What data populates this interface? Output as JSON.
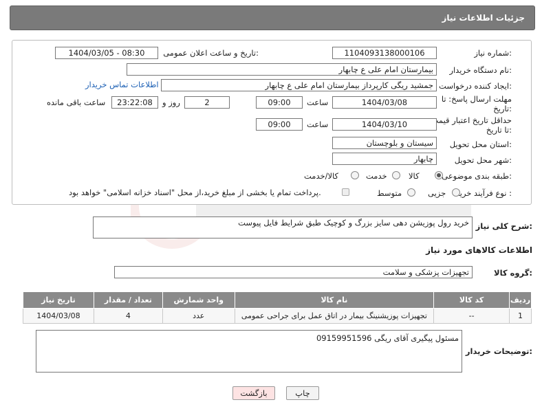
{
  "header": {
    "title": "جزئیات اطلاعات نیاز"
  },
  "form": {
    "need_number": {
      "label": "شماره نیاز:",
      "value": "1104093138000106"
    },
    "announce_datetime": {
      "label": "تاریخ و ساعت اعلان عمومی:",
      "value": "1404/03/05 - 08:30"
    },
    "buyer_org": {
      "label": "نام دستگاه خریدار:",
      "value": "بیمارستان امام علی  ع  چابهار"
    },
    "requester": {
      "label": "ایجاد کننده درخواست:",
      "value": "جمشید ریگی کارپرداز بیمارستان امام علی  ع  چابهار",
      "contact_link": "اطلاعات تماس خریدار"
    },
    "response_deadline": {
      "label": "مهلت ارسال پاسخ: تا تاریخ:",
      "date": "1404/03/08",
      "time_label": "ساعت",
      "time": "09:00",
      "days": "2",
      "days_label": "روز و",
      "remaining": "23:22:08",
      "remaining_label": "ساعت باقی مانده"
    },
    "price_validity": {
      "label": "حداقل تاریخ اعتبار قیمت: تا تاریخ:",
      "date": "1404/03/10",
      "time_label": "ساعت",
      "time": "09:00"
    },
    "delivery_province": {
      "label": "استان محل تحویل:",
      "value": "سیستان و بلوچستان"
    },
    "delivery_city": {
      "label": "شهر محل تحویل:",
      "value": "چابهار"
    },
    "category": {
      "label": "طبقه بندی موضوعی:",
      "options": [
        "کالا",
        "خدمت",
        "کالا/خدمت"
      ],
      "selected": "کالا"
    },
    "purchase_type": {
      "label": "نوع فرآیند خرید :",
      "options": [
        "جزیی",
        "متوسط"
      ],
      "selected": "",
      "payment_note": "پرداخت تمام یا بخشی از مبلغ خرید،از محل \"اسناد خزانه اسلامی\" خواهد بود."
    }
  },
  "description": {
    "label": "شرح کلی نیاز:",
    "value": "خرید رول پوزیشن دهی سایز بزرگ و کوچیک طبق شرایط فایل پیوست"
  },
  "goods_section": {
    "title": "اطلاعات کالاهای مورد نیاز"
  },
  "goods_group": {
    "label": "گروه کالا:",
    "value": "تجهیزات پزشکی و سلامت"
  },
  "items_table": {
    "headers": [
      "ردیف",
      "کد کالا",
      "نام کالا",
      "واحد شمارش",
      "تعداد / مقدار",
      "تاریخ نیاز"
    ],
    "rows": [
      [
        "1",
        "--",
        "تجهیزات پوزیشنینگ بیمار در اتاق عمل برای جراحی عمومی",
        "عدد",
        "4",
        "1404/03/08"
      ]
    ]
  },
  "buyer_notes": {
    "label": "توضیحات خریدار:",
    "value": "مسئول پیگیری آقای ریگی 09159951596"
  },
  "buttons": {
    "print": "چاپ",
    "back": "بازگشت"
  },
  "colors": {
    "header_bg": "#7a7a7a",
    "table_header_bg": "#8a8a8a",
    "link": "#1b5fb4",
    "back_button_bg": "#fde3e3"
  }
}
